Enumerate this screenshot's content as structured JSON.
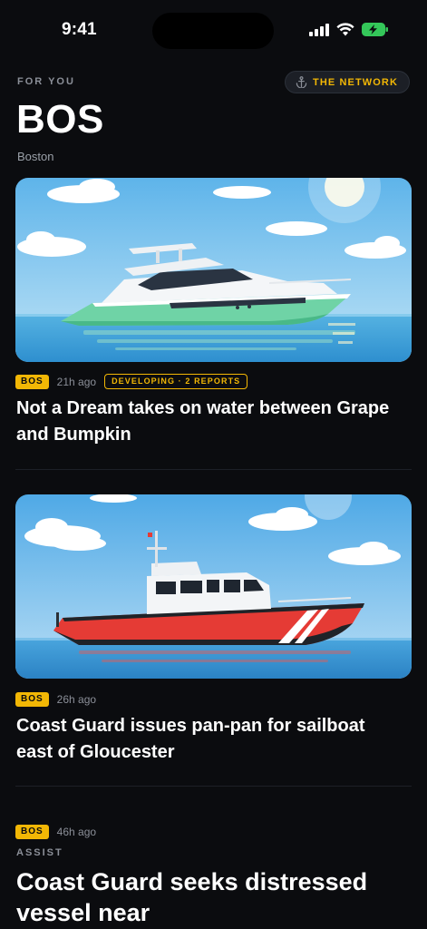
{
  "status_bar": {
    "time": "9:41"
  },
  "header": {
    "eyebrow": "FOR YOU",
    "network_label": "THE NETWORK",
    "title": "BOS",
    "subtitle": "Boston"
  },
  "feed": [
    {
      "badge": "BOS",
      "time": "21h ago",
      "status": "DEVELOPING · 2 REPORTS",
      "headline": "Not a Dream takes on water between Grape and Bumpkin",
      "image_icon": "motor-yacht-illustration"
    },
    {
      "badge": "BOS",
      "time": "26h ago",
      "headline": "Coast Guard issues pan-pan for sailboat east of Gloucester",
      "image_icon": "coast-guard-boat-illustration"
    },
    {
      "badge": "BOS",
      "time": "46h ago",
      "category": "ASSIST",
      "headline": "Coast Guard seeks distressed vessel near"
    }
  ],
  "colors": {
    "accent": "#f2b705",
    "background": "#0b0c0f",
    "battery": "#34c759"
  }
}
